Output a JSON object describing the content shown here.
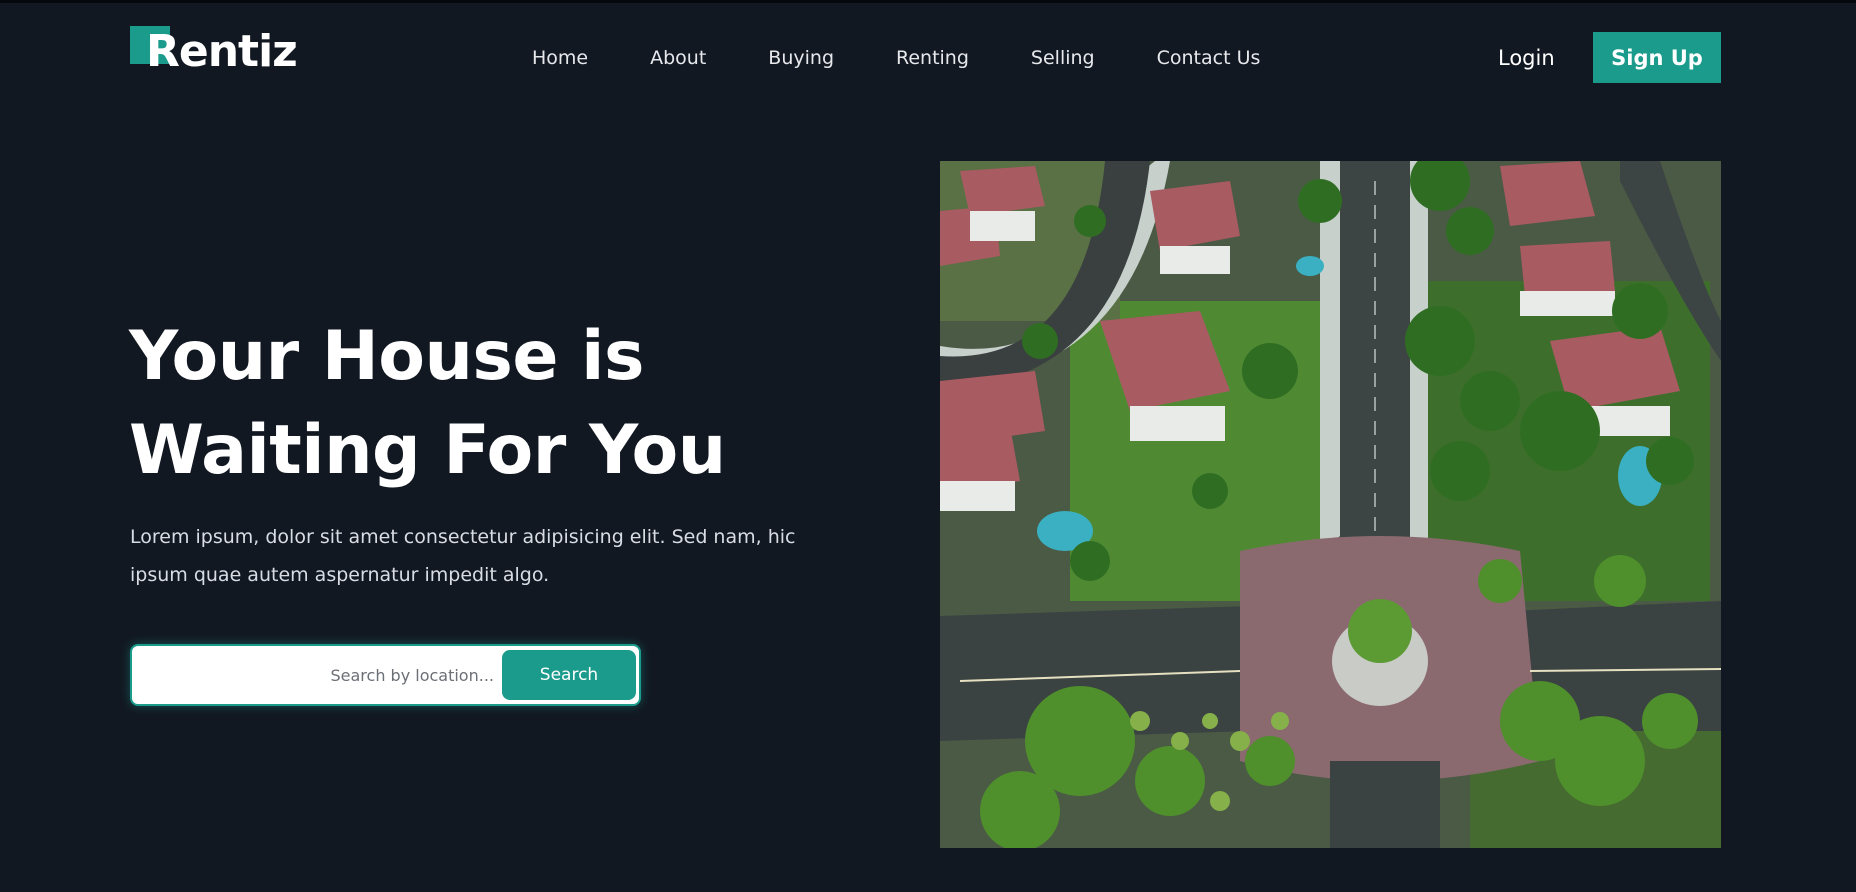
{
  "brand": {
    "name": "Rentiz",
    "accent": "#1a9b8c",
    "background": "#121822"
  },
  "nav": {
    "items": [
      "Home",
      "About",
      "Buying",
      "Renting",
      "Selling",
      "Contact Us"
    ]
  },
  "auth": {
    "login_label": "Login",
    "signup_label": "Sign Up"
  },
  "hero": {
    "title_line1": "Your House is",
    "title_line2": "Waiting For You",
    "description": "Lorem ipsum, dolor sit amet consectetur adipisicing elit. Sed nam, hic ipsum quae autem aspernatur impedit algo."
  },
  "search": {
    "placeholder": "Search by location...",
    "button_label": "Search"
  },
  "hero_image": {
    "subject": "aerial-suburban-neighborhood"
  }
}
